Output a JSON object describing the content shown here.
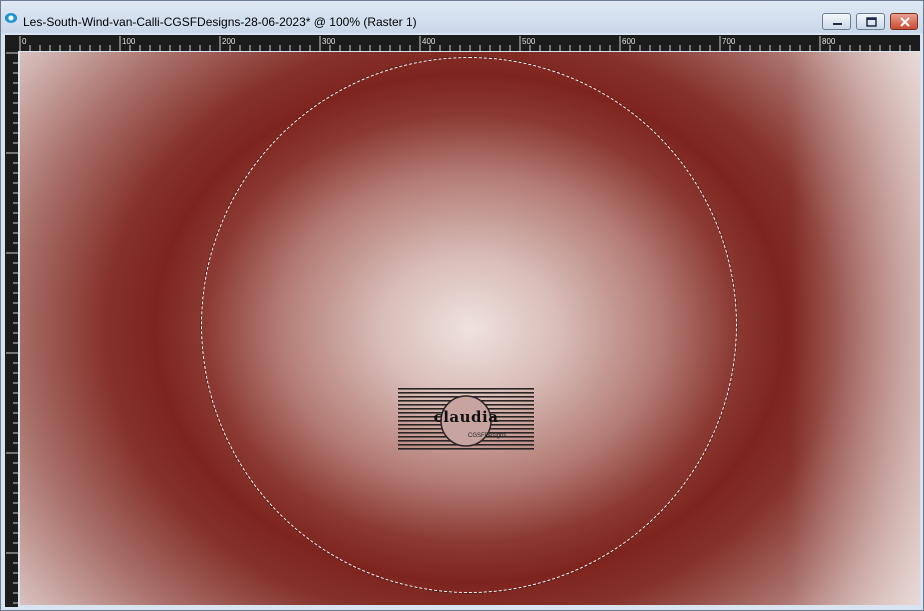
{
  "window": {
    "title": "Les-South-Wind-van-Calli-CGSFDesigns-28-06-2023* @ 100% (Raster 1)"
  },
  "controls": {
    "minimize": "minimize",
    "maximize": "maximize",
    "close": "close"
  },
  "ruler": {
    "top_labels": [
      "0",
      "100",
      "200",
      "300",
      "400",
      "500",
      "600",
      "700",
      "800"
    ]
  },
  "canvas": {
    "watermark_text": "claudia",
    "watermark_sub": "CGSFDesigns"
  },
  "colors": {
    "accent": "#7e241e",
    "center": "#efe2df",
    "ruler_bg": "#1c1c1c",
    "title_bar": "#d9e4f1"
  }
}
